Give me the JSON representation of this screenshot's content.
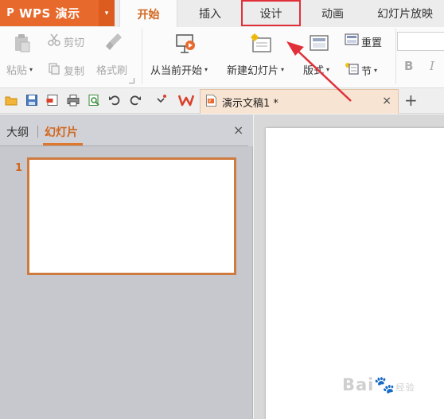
{
  "app": {
    "glyph": "P",
    "name": "WPS 演示",
    "menu_caret": "▾"
  },
  "tabs": [
    "开始",
    "插入",
    "设计",
    "动画",
    "幻灯片放映"
  ],
  "active_tab": "开始",
  "highlighted_tab": "设计",
  "ribbon": {
    "cut": "剪切",
    "paste": "粘贴",
    "copy": "复制",
    "format_painter": "格式刷",
    "play_from_current": "从当前开始",
    "new_slide": "新建幻灯片",
    "layout": "版式",
    "reset": "重置",
    "section": "节",
    "bold": "B",
    "italic": "I"
  },
  "document": {
    "title": "演示文稿1 *",
    "close": "×",
    "new_tab": "+"
  },
  "panel": {
    "outline_tab": "大纲",
    "slides_tab": "幻灯片",
    "close": "×",
    "slide_number": "1"
  },
  "watermark": {
    "text": "Bai",
    "paw": "🐾",
    "suffix": "经验"
  },
  "colors": {
    "accent": "#e8692c",
    "annotation": "#e0313a",
    "active_tab_text": "#d2661e"
  },
  "icons": [
    "paste-icon",
    "scissors-icon",
    "copy-icon",
    "brush-icon",
    "presentation-icon",
    "new-slide-icon",
    "layout-icon",
    "reset-icon",
    "section-icon",
    "folder-icon",
    "save-icon",
    "pdf-icon",
    "print-icon",
    "preview-icon",
    "undo-icon",
    "redo-icon",
    "wps-logo-icon",
    "document-icon"
  ]
}
